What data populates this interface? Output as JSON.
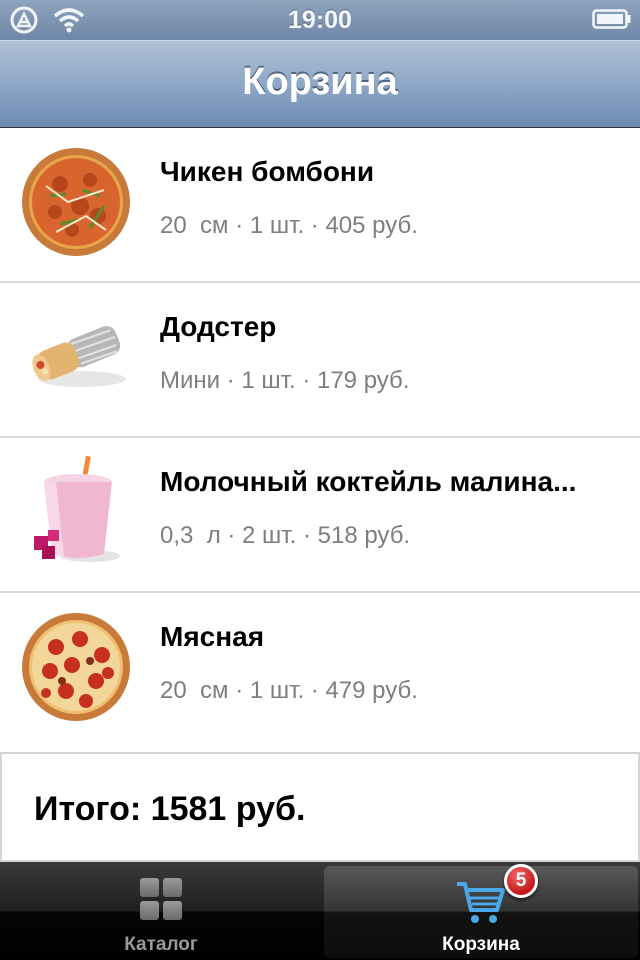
{
  "status_bar": {
    "time": "19:00"
  },
  "nav": {
    "title": "Корзина"
  },
  "cart": {
    "items": [
      {
        "name": "Чикен бомбони",
        "details": "20  см · 1 шт. · 405 руб.",
        "image": "pizza-chicken-bomboni"
      },
      {
        "name": "Додстер",
        "details": "Мини · 1 шт. · 179 руб.",
        "image": "dodster-wrap"
      },
      {
        "name": "Молочный коктейль малина...",
        "details": "0,3  л · 2 шт. · 518 руб.",
        "image": "raspberry-milkshake"
      },
      {
        "name": "Мясная",
        "details": "20  см · 1 шт. · 479 руб.",
        "image": "pizza-meat"
      }
    ],
    "total": "Итого: 1581 руб."
  },
  "tab_bar": {
    "tabs": [
      {
        "label": "Каталог",
        "icon": "grid-icon",
        "selected": false
      },
      {
        "label": "Корзина",
        "icon": "cart-icon",
        "selected": true,
        "badge": "5"
      }
    ]
  },
  "colors": {
    "badge": "#c61616",
    "cart_icon": "#4aa8e8",
    "nav_bar": "#8ea7c6"
  }
}
